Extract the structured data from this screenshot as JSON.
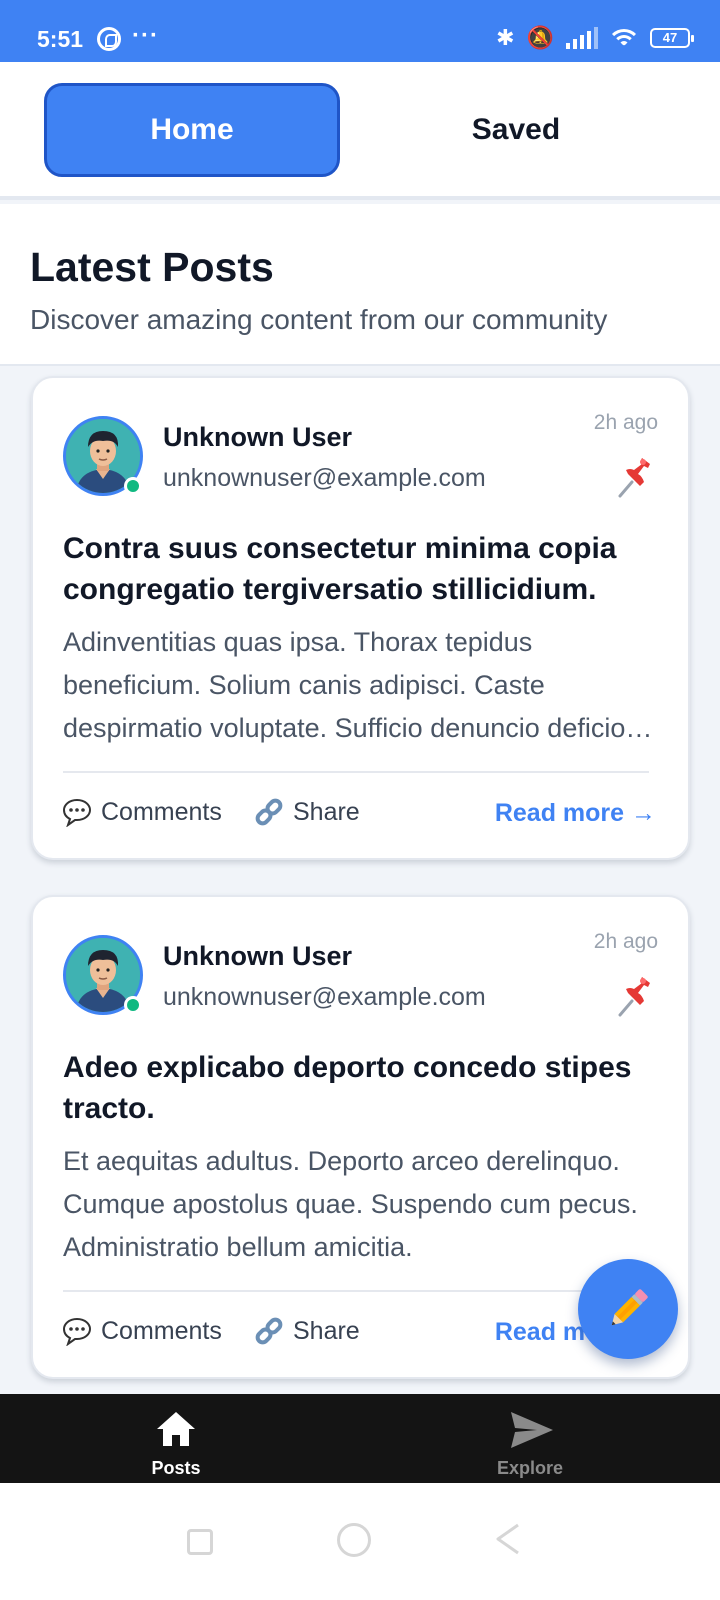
{
  "status_bar": {
    "time": "5:51",
    "dots": "···",
    "battery": "47",
    "icons": [
      "whatsapp-icon",
      "bluetooth-icon",
      "mute-icon",
      "signal-icon",
      "wifi-icon",
      "battery-icon"
    ]
  },
  "tabs": {
    "home": "Home",
    "saved": "Saved",
    "active": "home"
  },
  "header": {
    "title": "Latest Posts",
    "subtitle": "Discover amazing content from our community"
  },
  "posts": [
    {
      "author_name": "Unknown User",
      "author_email": "unknownuser@example.com",
      "time": "2h ago",
      "title": "Contra suus consectetur minima copia congregatio tergiversatio stillicidium.",
      "excerpt": "Adinventitias quas ipsa. Thorax tepidus beneficium. Solium canis adipisci. Caste despirmatio voluptate. Sufficio denuncio deficio saepe.",
      "comments_label": "Comments",
      "share_label": "Share",
      "read_more_label": "Read more →"
    },
    {
      "author_name": "Unknown User",
      "author_email": "unknownuser@example.com",
      "time": "2h ago",
      "title": "Adeo explicabo deporto concedo stipes tracto.",
      "excerpt": "Et aequitas adultus. Deporto arceo derelinquo. Cumque apostolus quae. Suspendo cum pecus. Administratio bellum amicitia.",
      "comments_label": "Comments",
      "share_label": "Share",
      "read_more_label": "Read more →"
    }
  ],
  "bottom_nav": {
    "posts": "Posts",
    "explore": "Explore",
    "active": "posts"
  },
  "colors": {
    "accent": "#3f82f3",
    "online": "#10b981",
    "text_primary": "#111827",
    "text_secondary": "#4a5565",
    "nav_bg": "#141414"
  }
}
